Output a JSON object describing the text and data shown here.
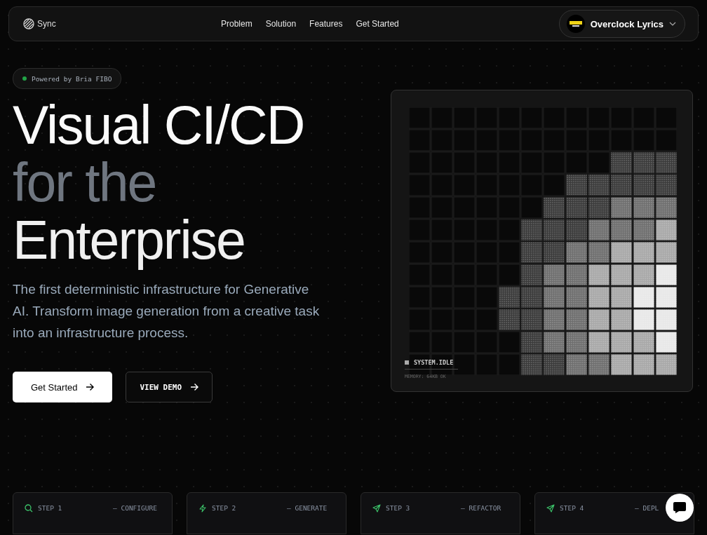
{
  "nav": {
    "logo": "Sync",
    "links": [
      "Problem",
      "Solution",
      "Features",
      "Get Started"
    ],
    "account": {
      "name": "Overclock Lyrics"
    }
  },
  "badge": {
    "text": "Powered by Bria FIBO",
    "color": "#22a447"
  },
  "headline": [
    "Visual CI/CD",
    "for the",
    "Enterprise"
  ],
  "description": "The first deterministic infrastructure for Generative AI. Transform image generation from a creative task into an infrastructure process.",
  "buttons": [
    {
      "label": "Get Started",
      "kind": "primary"
    },
    {
      "label": "VIEW DEMO",
      "kind": "outline"
    }
  ],
  "panel": {
    "status": "SYSTEM.IDLE",
    "memory": "MEMORY: 64KB OK"
  },
  "steps": [
    {
      "label": "STEP 1",
      "title": "— CONFIGURE"
    },
    {
      "label": "STEP 2",
      "title": "— GENERATE"
    },
    {
      "label": "STEP 3",
      "title": "— REFACTOR"
    },
    {
      "label": "STEP 4",
      "title": "— DEPL"
    }
  ]
}
